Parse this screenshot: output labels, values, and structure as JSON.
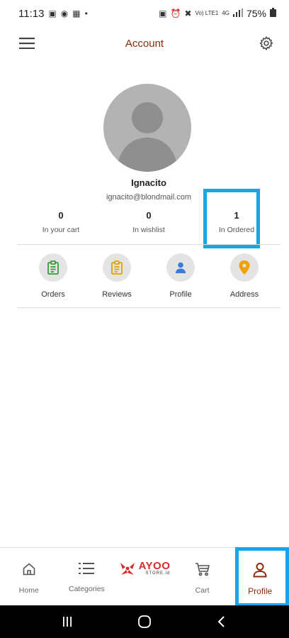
{
  "status_bar": {
    "time": "11:13",
    "network": "Vo) LTE1",
    "network_type": "4G",
    "battery": "75%"
  },
  "header": {
    "title": "Account",
    "menu_icon": "hamburger-icon",
    "settings_icon": "gear-icon"
  },
  "profile": {
    "name": "Ignacito",
    "email": "ignacito@blondmail.com"
  },
  "stats": [
    {
      "value": "0",
      "label": "In your cart"
    },
    {
      "value": "0",
      "label": "In wishlist"
    },
    {
      "value": "1",
      "label": "In Ordered"
    }
  ],
  "quick_links": [
    {
      "label": "Orders",
      "icon": "clipboard-icon",
      "color": "#3a9a3a"
    },
    {
      "label": "Reviews",
      "icon": "clipboard-icon",
      "color": "#e0a400"
    },
    {
      "label": "Profile",
      "icon": "person-icon",
      "color": "#3b7bd8"
    },
    {
      "label": "Address",
      "icon": "location-pin-icon",
      "color": "#f0a000"
    }
  ],
  "bottom_nav": {
    "home": "Home",
    "categories": "Categories",
    "brand": "AYOO",
    "brand_sub": "STORE.id",
    "cart": "Cart",
    "profile": "Profile"
  },
  "colors": {
    "accent": "#8a2c0c",
    "highlight": "#1aa6e6",
    "brand": "#d92b2b"
  }
}
